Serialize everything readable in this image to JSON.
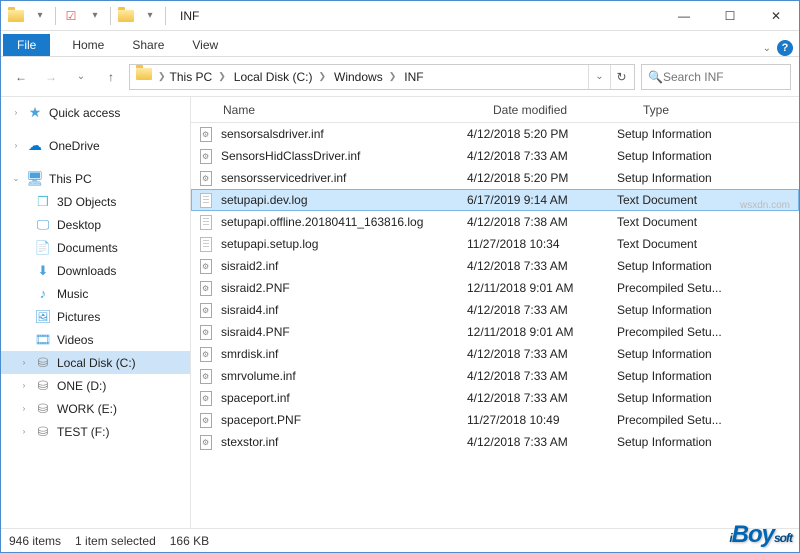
{
  "title": "INF",
  "tabs": {
    "file": "File",
    "home": "Home",
    "share": "Share",
    "view": "View"
  },
  "breadcrumb": {
    "items": [
      "This PC",
      "Local Disk (C:)",
      "Windows",
      "INF"
    ]
  },
  "search": {
    "placeholder": "Search INF"
  },
  "nav": {
    "quick": "Quick access",
    "onedrive": "OneDrive",
    "thispc": "This PC",
    "children": [
      "3D Objects",
      "Desktop",
      "Documents",
      "Downloads",
      "Music",
      "Pictures",
      "Videos",
      "Local Disk (C:)",
      "ONE (D:)",
      "WORK (E:)",
      "TEST (F:)"
    ],
    "selected": "Local Disk (C:)"
  },
  "columns": {
    "name": "Name",
    "date": "Date modified",
    "type": "Type"
  },
  "rows": [
    {
      "name": "sensorsalsdriver.inf",
      "date": "4/12/2018 5:20 PM",
      "type": "Setup Information",
      "ic": "inf"
    },
    {
      "name": "SensorsHidClassDriver.inf",
      "date": "4/12/2018 7:33 AM",
      "type": "Setup Information",
      "ic": "inf"
    },
    {
      "name": "sensorsservicedriver.inf",
      "date": "4/12/2018 5:20 PM",
      "type": "Setup Information",
      "ic": "inf"
    },
    {
      "name": "setupapi.dev.log",
      "date": "6/17/2019 9:14 AM",
      "type": "Text Document",
      "ic": "txt",
      "selected": true
    },
    {
      "name": "setupapi.offline.20180411_163816.log",
      "date": "4/12/2018 7:38 AM",
      "type": "Text Document",
      "ic": "txt"
    },
    {
      "name": "setupapi.setup.log",
      "date": "11/27/2018 10:34",
      "type": "Text Document",
      "ic": "txt"
    },
    {
      "name": "sisraid2.inf",
      "date": "4/12/2018 7:33 AM",
      "type": "Setup Information",
      "ic": "inf"
    },
    {
      "name": "sisraid2.PNF",
      "date": "12/11/2018 9:01 AM",
      "type": "Precompiled Setu...",
      "ic": "inf"
    },
    {
      "name": "sisraid4.inf",
      "date": "4/12/2018 7:33 AM",
      "type": "Setup Information",
      "ic": "inf"
    },
    {
      "name": "sisraid4.PNF",
      "date": "12/11/2018 9:01 AM",
      "type": "Precompiled Setu...",
      "ic": "inf"
    },
    {
      "name": "smrdisk.inf",
      "date": "4/12/2018 7:33 AM",
      "type": "Setup Information",
      "ic": "inf"
    },
    {
      "name": "smrvolume.inf",
      "date": "4/12/2018 7:33 AM",
      "type": "Setup Information",
      "ic": "inf"
    },
    {
      "name": "spaceport.inf",
      "date": "4/12/2018 7:33 AM",
      "type": "Setup Information",
      "ic": "inf"
    },
    {
      "name": "spaceport.PNF",
      "date": "11/27/2018 10:49",
      "type": "Precompiled Setu...",
      "ic": "inf"
    },
    {
      "name": "stexstor.inf",
      "date": "4/12/2018 7:33 AM",
      "type": "Setup Information",
      "ic": "inf"
    }
  ],
  "status": {
    "count": "946 items",
    "sel": "1 item selected",
    "size": "166 KB"
  },
  "watermark": "iBoysoft",
  "wmurl": "wsxdn.com"
}
